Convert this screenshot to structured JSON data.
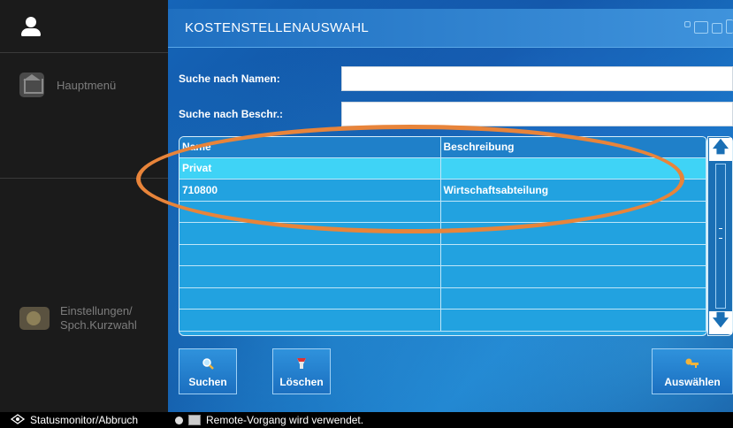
{
  "sidebar": {
    "items": [
      {
        "label": "Hauptmenü",
        "icon": "home-icon"
      },
      {
        "label_line1": "Einstellungen/",
        "label_line2": "Spch.Kurzwahl",
        "icon": "settings-icon"
      }
    ]
  },
  "window": {
    "title": "KOSTENSTELLENAUSWAHL"
  },
  "search": {
    "name_label": "Suche nach Namen:",
    "name_value": "",
    "desc_label": "Suche nach Beschr.:",
    "desc_value": ""
  },
  "table": {
    "columns": [
      "Name",
      "Beschreibung"
    ],
    "rows": [
      [
        "Privat",
        ""
      ],
      [
        "710800",
        "Wirtschaftsabteilung"
      ],
      [
        "",
        ""
      ],
      [
        "",
        ""
      ],
      [
        "",
        ""
      ],
      [
        "",
        ""
      ],
      [
        "",
        ""
      ],
      [
        "",
        ""
      ]
    ]
  },
  "buttons": {
    "search": "Suchen",
    "delete": "Löschen",
    "select": "Auswählen"
  },
  "statusbar": {
    "left": "Statusmonitor/Abbruch",
    "message": "Remote-Vorgang wird verwendet."
  },
  "colors": {
    "highlight_ellipse": "#e8843a",
    "selected_row": "#3fd3f6",
    "sidebar_bg": "#1b1b1b"
  }
}
